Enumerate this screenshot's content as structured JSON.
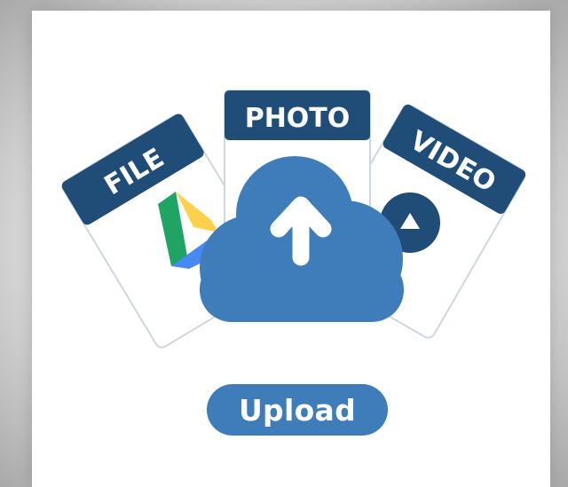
{
  "documents": {
    "file": {
      "label": "FILE",
      "icon": "drive-icon"
    },
    "photo": {
      "label": "PHOTO",
      "icon": "cloud-upload-icon"
    },
    "video": {
      "label": "VIDEO",
      "icon": "play-icon"
    }
  },
  "upload": {
    "label": "Upload"
  },
  "colors": {
    "label_band": "#1f4d78",
    "cloud": "#3f7dba",
    "button": "#3f7dba",
    "doc_border": "#cfd6e0",
    "drive_green": "#1fa463",
    "drive_yellow": "#ffd04b",
    "drive_blue": "#4688f4"
  }
}
